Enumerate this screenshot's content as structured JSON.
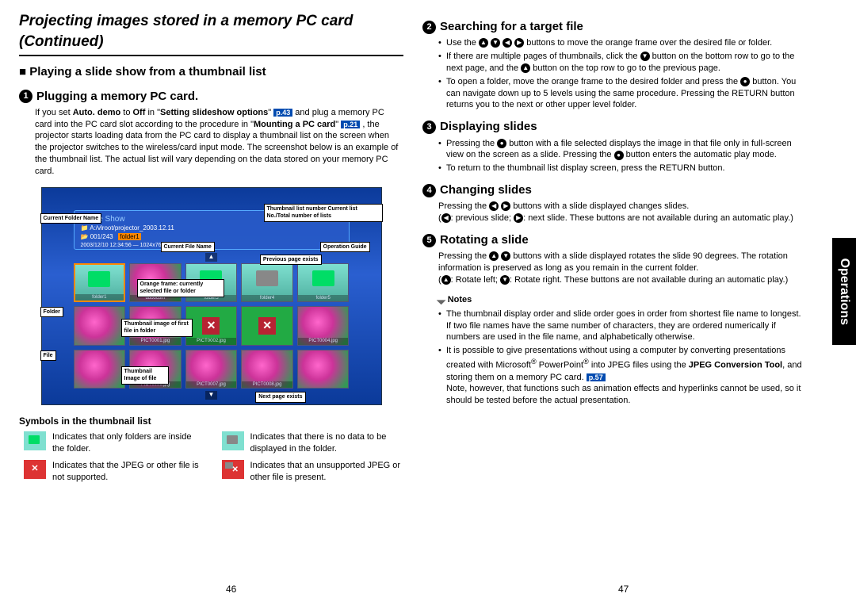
{
  "title": "Projecting images stored in a memory PC card (Continued)",
  "side_tab": "Operations",
  "page_left": "46",
  "page_right": "47",
  "left": {
    "h_playing": "■ Playing a slide show from a thumbnail list",
    "s1_num": "1",
    "s1_title": "Plugging a memory PC card.",
    "p1a": "If you set ",
    "p1_bold1": "Auto. demo",
    "p1b": " to ",
    "p1_bold2": "Off",
    "p1c": " in \"",
    "p1_bold3": "Setting slideshow options",
    "p1d": "\" ",
    "p1_ref1": "p.43",
    "p1e": " and plug a memory PC card into the PC card slot according to the procedure in \"",
    "p1_bold4": "Mounting a PC card",
    "p1f": "\" ",
    "p1_ref2": "p.21",
    "p1g": " , the projector starts loading data from the PC card to display a thumbnail list on the screen when the projector switches to the wireless/card input mode. The screenshot below is an example of the thumbnail list. The actual list will vary depending on the data stored on your memory PC card.",
    "legend_h": "Symbols in the thumbnail list",
    "legend": [
      "Indicates that only folders are inside the folder.",
      "Indicates that there is no data to be displayed in the folder.",
      "Indicates that the JPEG or other file is not supported.",
      "Indicates that an unsupported JPEG or other file is present."
    ],
    "shot": {
      "window_title": "Slide Show",
      "path": "A:/vlroot/projector_2003.12.11",
      "counter": "001/243",
      "folder_sel": "folder1",
      "date_line": "2003/12/10 12:34:56",
      "size_line": "1024x768 65536 / 0001x0200",
      "callouts": {
        "cfn": "Current Folder Name",
        "tln": "Thumbnail list number\nCurrent list No./Total number of lists",
        "cfile": "Current File Name",
        "op": "Operation Guide",
        "prev": "Previous page exists",
        "orange": "Orange frame: currently selected file or folder",
        "folder": "Folder",
        "thumb1": "Thumbnail image of first file in folder",
        "file": "File",
        "thumb2": "Thumbnail Image of file",
        "next": "Next page exists"
      },
      "cells": [
        "folder1",
        "udoocom",
        "folder3",
        "folder4",
        "folder5",
        "",
        "PICT0001.jpg",
        "PICT0002.jpg",
        "",
        "PICT0004.jpg",
        "",
        "PICT0006.jpg",
        "PICT0007.jpg",
        "PICT0008.jpg",
        ""
      ]
    }
  },
  "right": {
    "s2_num": "2",
    "s2_title": "Searching for a target file",
    "s2_li1a": "Use the ",
    "s2_li1b": " buttons to move the orange frame over the desired file or folder.",
    "s2_li2a": "If there are multiple pages of thumbnails, click the ",
    "s2_li2b": " button on the bottom row to go to the next page, and the ",
    "s2_li2c": " button on the top row to go to the previous page.",
    "s2_li3a": "To open a folder, move the orange frame to the desired folder and press the ",
    "s2_li3b": " button. You can navigate down up to 5 levels using the same procedure. Pressing the RETURN button returns you to the next or other upper level folder.",
    "s3_num": "3",
    "s3_title": "Displaying slides",
    "s3_li1a": "Pressing the ",
    "s3_li1b": " button with a file selected displays the image in that file only in full-screen view on the screen as a slide. Pressing the ",
    "s3_li1c": " button enters the automatic play mode.",
    "s3_li2": "To return to the thumbnail list display screen, press the RETURN button.",
    "s4_num": "4",
    "s4_title": "Changing slides",
    "s4_pa": "Pressing the ",
    "s4_pb": " buttons with a slide displayed changes slides.",
    "s4_pc": "(",
    "s4_pd": ": previous slide; ",
    "s4_pe": ": next slide. These buttons are not available during an automatic play.)",
    "s5_num": "5",
    "s5_title": "Rotating a slide",
    "s5_pa": "Pressing the ",
    "s5_pb": " buttons with a slide displayed rotates the slide 90 degrees. The rotation information is preserved as long as you remain in the current folder.",
    "s5_pc": "(",
    "s5_pd": ": Rotate left; ",
    "s5_pe": ": Rotate right. These buttons are not available during an automatic play.)",
    "notes_h": "Notes",
    "n1": "The thumbnail display order and slide order goes in order from shortest file name to longest. If two file names have the same number of characters, they are ordered numerically if numbers are used in the file name, and alphabetically otherwise.",
    "n2a": "It is possible to give presentations without using a computer by converting presentations created with Microsoft",
    "n2b": " PowerPoint",
    "n2c": " into JPEG files using the ",
    "n2_bold": "JPEG Conversion Tool",
    "n2d": ", and storing them on a memory PC card. ",
    "n2_ref": "p.57",
    "n2e": "Note, however, that functions such as animation effects and hyperlinks cannot be used, so it should be tested before the actual presentation."
  }
}
